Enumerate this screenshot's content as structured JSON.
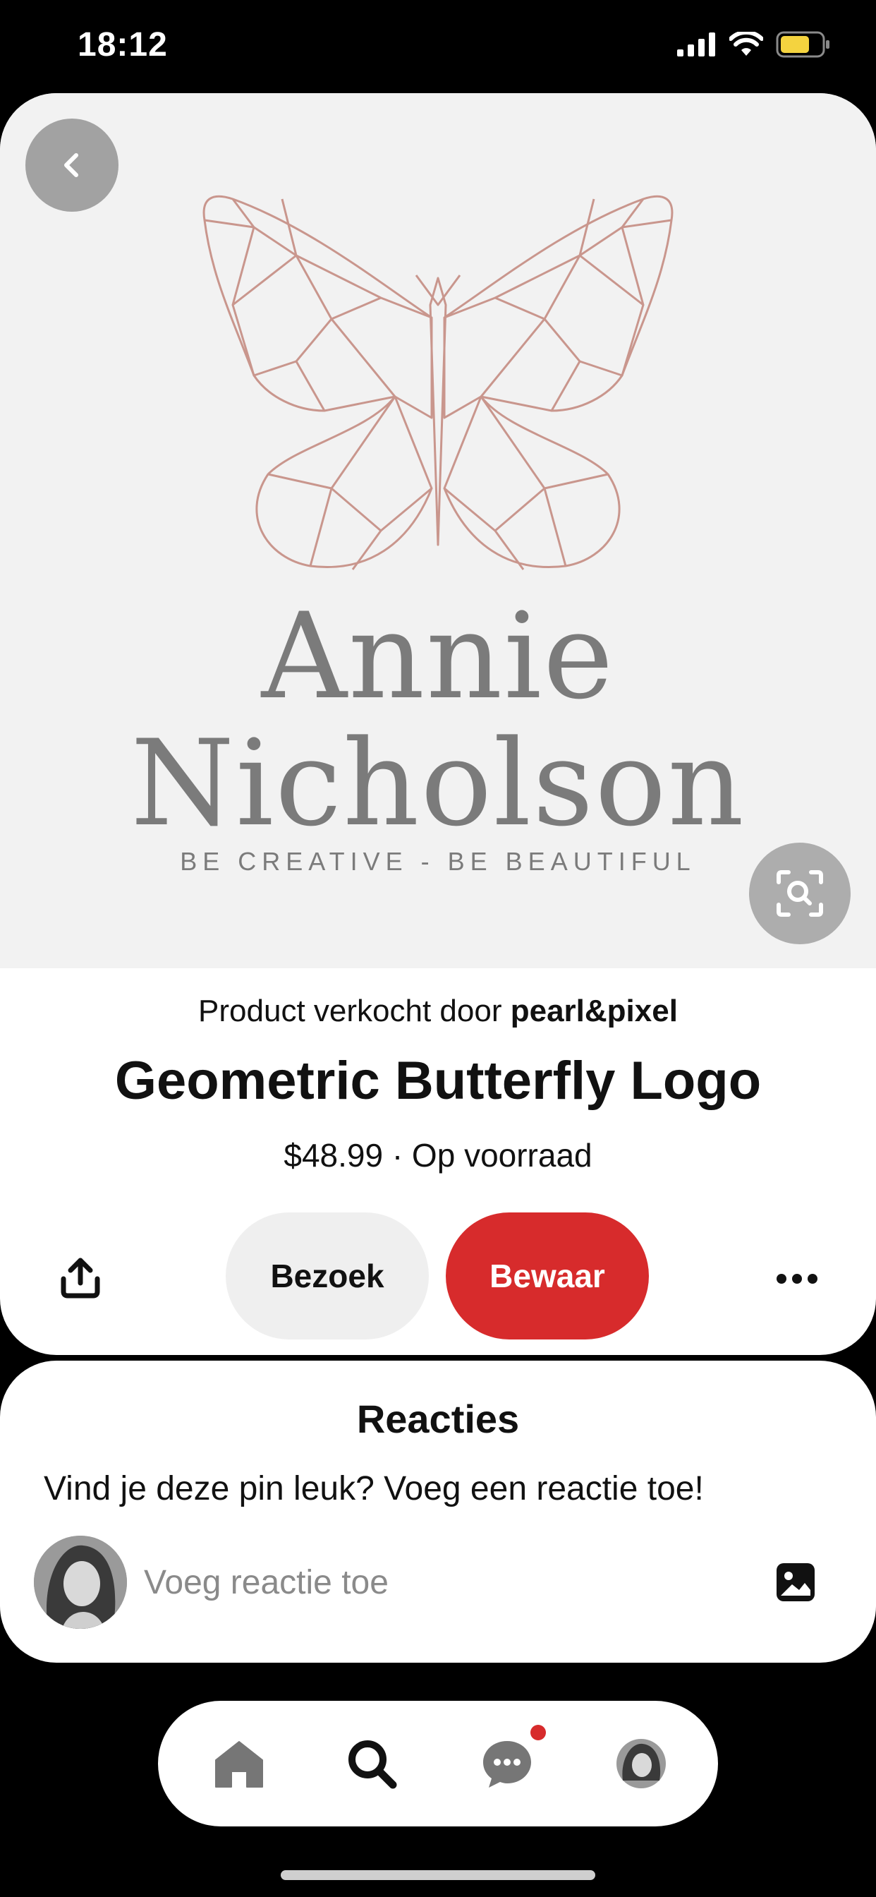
{
  "status_bar": {
    "time": "18:12"
  },
  "pin": {
    "logo": {
      "name_line1": "Annie",
      "name_line2": "Nicholson",
      "tagline": "BE CREATIVE - BE BEAUTIFUL"
    },
    "seller_prefix": "Product verkocht door",
    "seller_name": "pearl&pixel",
    "title": "Geometric Butterfly Logo",
    "price_line": "$48.99 · Op voorraad",
    "visit_label": "Bezoek",
    "save_label": "Bewaar"
  },
  "comments": {
    "title": "Reacties",
    "prompt": "Vind je deze pin leuk? Voeg een reactie toe!",
    "input_placeholder": "Voeg reactie toe"
  },
  "icons": {
    "back": "chevron-left-icon",
    "lens": "visual-search-icon",
    "share": "share-icon",
    "more": "more-dots-icon",
    "attach": "image-icon",
    "home": "home-icon",
    "search": "search-icon",
    "messages": "chat-bubble-icon"
  },
  "colors": {
    "brand_red": "#d72b2c",
    "logo_rose_gold": "#c9968d"
  }
}
